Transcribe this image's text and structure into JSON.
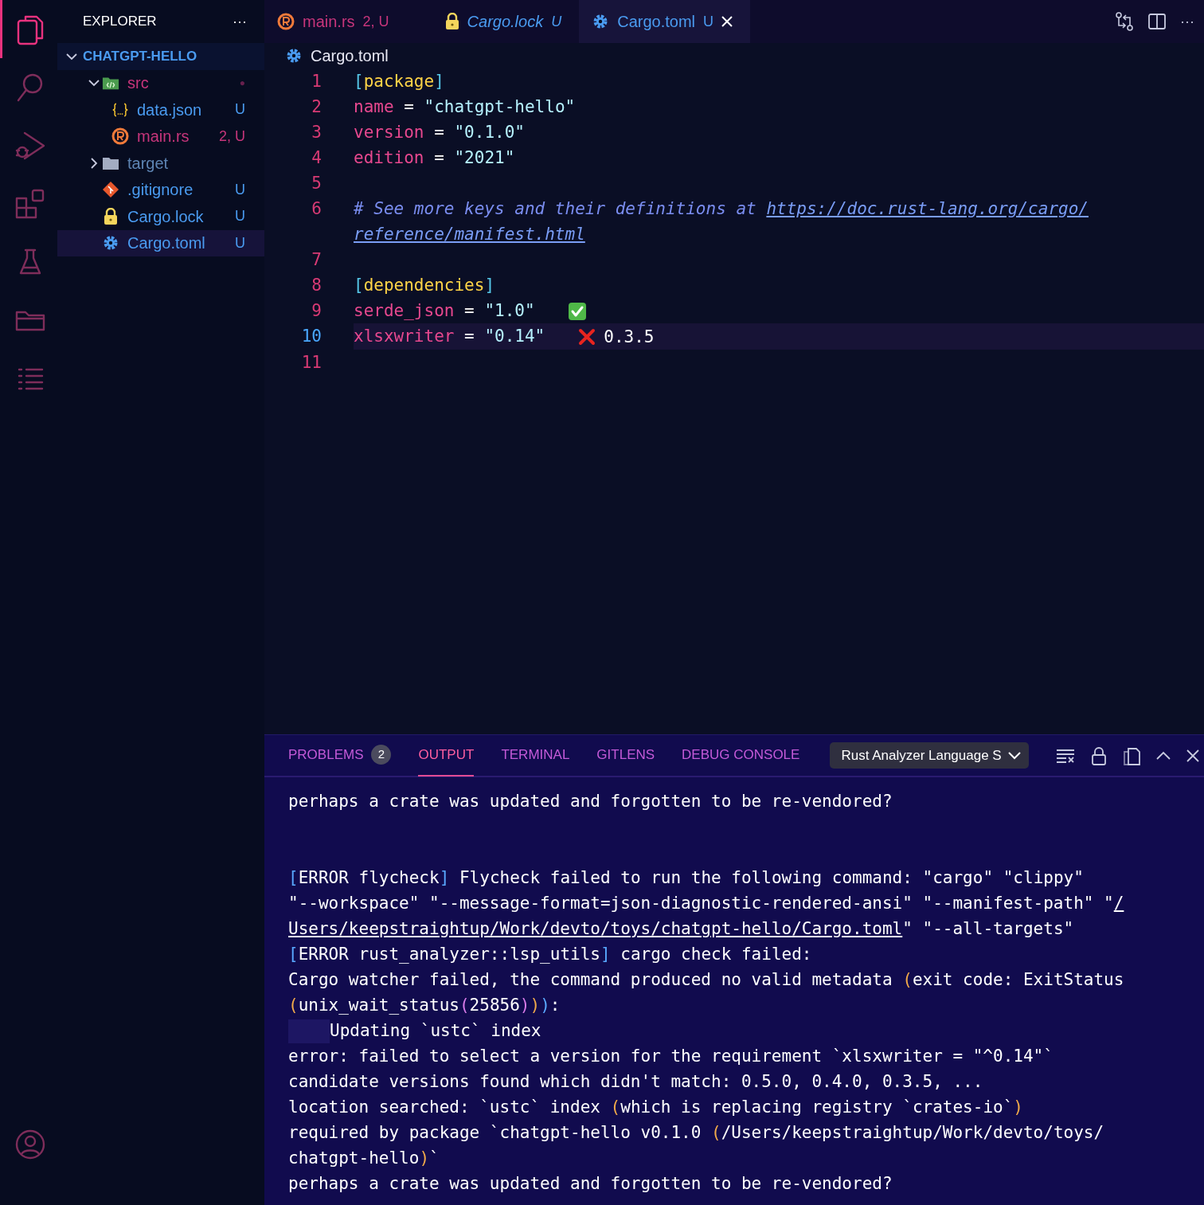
{
  "activity_bar": {
    "items": [
      {
        "kind": "files",
        "selected": true
      },
      {
        "kind": "search",
        "selected": false
      },
      {
        "kind": "debug",
        "selected": false
      },
      {
        "kind": "extensions",
        "selected": false
      },
      {
        "kind": "testing",
        "selected": false
      },
      {
        "kind": "folder",
        "selected": false
      },
      {
        "kind": "list",
        "selected": false
      }
    ],
    "bottom": [
      {
        "kind": "account",
        "selected": false
      }
    ]
  },
  "sidebar": {
    "title": "EXPLORER",
    "more": "···",
    "root": {
      "label": "CHATGPT-HELLO",
      "expanded": true,
      "children": [
        {
          "label": "src",
          "kind": "src-folder",
          "problems": true,
          "ignored": false,
          "badge": "●",
          "expanded": true,
          "selected": false,
          "children": [
            {
              "label": "data.json",
              "kind": "json",
              "problems": false,
              "ignored": false,
              "badge": "U",
              "selected": false
            },
            {
              "label": "main.rs",
              "kind": "rust",
              "problems": true,
              "ignored": false,
              "badge": "2, U",
              "selected": false
            }
          ]
        },
        {
          "label": "target",
          "kind": "folder",
          "problems": false,
          "ignored": true,
          "expanded": false,
          "selected": false
        },
        {
          "label": ".gitignore",
          "kind": "git",
          "problems": false,
          "ignored": false,
          "badge": "U",
          "selected": false
        },
        {
          "label": "Cargo.lock",
          "kind": "lock",
          "problems": false,
          "ignored": false,
          "badge": "U",
          "selected": false
        },
        {
          "label": "Cargo.toml",
          "kind": "gear",
          "problems": false,
          "ignored": false,
          "badge": "U",
          "selected": true
        }
      ]
    }
  },
  "tabs": [
    {
      "label": "main.rs",
      "badge": "2, U",
      "kind": "rust",
      "problems": true,
      "preview": false,
      "selected": false
    },
    {
      "label": "Cargo.lock",
      "badge": "U",
      "kind": "lock",
      "problems": false,
      "preview": true,
      "selected": false
    },
    {
      "label": "Cargo.toml",
      "badge": "U",
      "kind": "gear",
      "problems": false,
      "preview": false,
      "selected": true
    }
  ],
  "editor_actions": [
    {
      "kind": "compare"
    },
    {
      "kind": "split"
    },
    {
      "kind": "more",
      "text": "···"
    }
  ],
  "breadcrumb": {
    "kind": "gear",
    "label": "Cargo.toml"
  },
  "editor": {
    "lines": [
      {
        "number": "1",
        "current": false,
        "tokens": [
          {
            "kind": "bracket",
            "text": "["
          },
          {
            "kind": "section",
            "text": "package"
          },
          {
            "kind": "bracket",
            "text": "]"
          }
        ]
      },
      {
        "number": "2",
        "current": false,
        "tokens": [
          {
            "kind": "key",
            "text": "name"
          },
          {
            "kind": "op",
            "text": " = "
          },
          {
            "kind": "string",
            "text": "\"chatgpt-hello\""
          }
        ]
      },
      {
        "number": "3",
        "current": false,
        "tokens": [
          {
            "kind": "key",
            "text": "version"
          },
          {
            "kind": "op",
            "text": " = "
          },
          {
            "kind": "string",
            "text": "\"0.1.0\""
          }
        ]
      },
      {
        "number": "4",
        "current": false,
        "tokens": [
          {
            "kind": "key",
            "text": "edition"
          },
          {
            "kind": "op",
            "text": " = "
          },
          {
            "kind": "string",
            "text": "\"2021\""
          }
        ]
      },
      {
        "number": "5",
        "current": false
      },
      {
        "number": "6",
        "current": false,
        "tokens": [
          {
            "kind": "comment",
            "text": "# See more keys and their definitions at "
          },
          {
            "kind": "link",
            "text": "https://doc.rust-lang.org/cargo/"
          }
        ],
        "continuation": [
          {
            "kind": "link",
            "text": "reference/manifest.html"
          }
        ]
      },
      {
        "number": "7",
        "current": false
      },
      {
        "number": "8",
        "current": false,
        "tokens": [
          {
            "kind": "bracket",
            "text": "["
          },
          {
            "kind": "section",
            "text": "dependencies"
          },
          {
            "kind": "bracket",
            "text": "]"
          }
        ]
      },
      {
        "number": "9",
        "current": false,
        "tokens": [
          {
            "kind": "key",
            "text": "serde_json"
          },
          {
            "kind": "op",
            "text": " = "
          },
          {
            "kind": "string",
            "text": "\"1.0\""
          }
        ],
        "check": {
          "passed": true
        }
      },
      {
        "number": "10",
        "current": true,
        "tokens": [
          {
            "kind": "key",
            "text": "xlsxwriter"
          },
          {
            "kind": "op",
            "text": " = "
          },
          {
            "kind": "string",
            "text": "\"0.14\""
          }
        ],
        "check": {
          "passed": false,
          "hint": "0.3.5"
        }
      },
      {
        "number": "11",
        "current": false
      }
    ]
  },
  "panel": {
    "tabs": [
      {
        "label": "PROBLEMS",
        "count": "2",
        "selected": false
      },
      {
        "label": "OUTPUT",
        "selected": true
      },
      {
        "label": "TERMINAL",
        "selected": false
      },
      {
        "label": "GITLENS",
        "selected": false
      },
      {
        "label": "DEBUG CONSOLE",
        "selected": false
      }
    ],
    "channel": "Rust Analyzer Language S",
    "actions": [
      {
        "kind": "clear"
      },
      {
        "kind": "lock"
      },
      {
        "kind": "copy"
      },
      {
        "kind": "maximize"
      },
      {
        "kind": "close"
      }
    ],
    "output": [
      [
        {
          "tokens": [
            {
              "kind": "text",
              "text": "perhaps a crate was updated and forgotten to be re-vendored?"
            }
          ]
        }
      ],
      [
        {
          "tokens": [
            {
              "kind": "bracket",
              "text": "["
            },
            {
              "kind": "text",
              "text": "ERROR flycheck"
            },
            {
              "kind": "bracket",
              "text": "]"
            },
            {
              "kind": "text",
              "text": " Flycheck failed to run the following command: \"cargo\" \"clippy\""
            }
          ]
        },
        {
          "tokens": [
            {
              "kind": "text",
              "text": "\"--workspace\" \"--message-format=json-diagnostic-rendered-ansi\" \"--manifest-path\" \""
            },
            {
              "kind": "link",
              "text": "/"
            }
          ]
        },
        {
          "tokens": [
            {
              "kind": "link",
              "text": "Users/keepstraightup/Work/devto/toys/chatgpt-hello/Cargo.toml"
            },
            {
              "kind": "text",
              "text": "\" \"--all-targets\""
            }
          ]
        },
        {
          "tokens": [
            {
              "kind": "bracket",
              "text": "["
            },
            {
              "kind": "text",
              "text": "ERROR rust_analyzer::lsp_utils"
            },
            {
              "kind": "bracket",
              "text": "]"
            },
            {
              "kind": "text",
              "text": " cargo check failed:"
            }
          ]
        },
        {
          "tokens": [
            {
              "kind": "text",
              "text": "Cargo watcher failed, the command produced no valid metadata "
            },
            {
              "kind": "paren",
              "text": "("
            },
            {
              "kind": "text",
              "text": "exit code: ExitStatus"
            }
          ]
        },
        {
          "tokens": [
            {
              "kind": "paren",
              "text": "("
            },
            {
              "kind": "text",
              "text": "unix_wait_status"
            },
            {
              "kind": "paren2",
              "text": "("
            },
            {
              "kind": "text",
              "text": "25856"
            },
            {
              "kind": "paren2",
              "text": ")"
            },
            {
              "kind": "paren",
              "text": ")"
            },
            {
              "kind": "paren3",
              "text": ")"
            },
            {
              "kind": "text",
              "text": ":"
            }
          ]
        },
        {
          "indent": true,
          "tokens": [
            {
              "kind": "text",
              "text": "Updating `ustc` index"
            }
          ]
        },
        {
          "tokens": [
            {
              "kind": "text",
              "text": "error: failed to select a version for the requirement `xlsxwriter = \"^0.14\"`"
            }
          ]
        },
        {
          "tokens": [
            {
              "kind": "text",
              "text": "candidate versions found which didn't match: 0.5.0, 0.4.0, 0.3.5, ..."
            }
          ]
        },
        {
          "tokens": [
            {
              "kind": "text",
              "text": "location searched: `ustc` index "
            },
            {
              "kind": "paren",
              "text": "("
            },
            {
              "kind": "text",
              "text": "which is replacing registry `crates-io`"
            },
            {
              "kind": "paren",
              "text": ")"
            }
          ]
        },
        {
          "tokens": [
            {
              "kind": "text",
              "text": "required by package `chatgpt-hello v0.1.0 "
            },
            {
              "kind": "paren",
              "text": "("
            },
            {
              "kind": "text",
              "text": "/Users/keepstraightup/Work/devto/toys/"
            }
          ]
        },
        {
          "tokens": [
            {
              "kind": "text",
              "text": "chatgpt-hello"
            },
            {
              "kind": "paren",
              "text": ")"
            },
            {
              "kind": "text",
              "text": "`"
            }
          ]
        },
        {
          "tokens": [
            {
              "kind": "text",
              "text": "perhaps a crate was updated and forgotten to be re-vendored?"
            }
          ]
        }
      ]
    ]
  }
}
